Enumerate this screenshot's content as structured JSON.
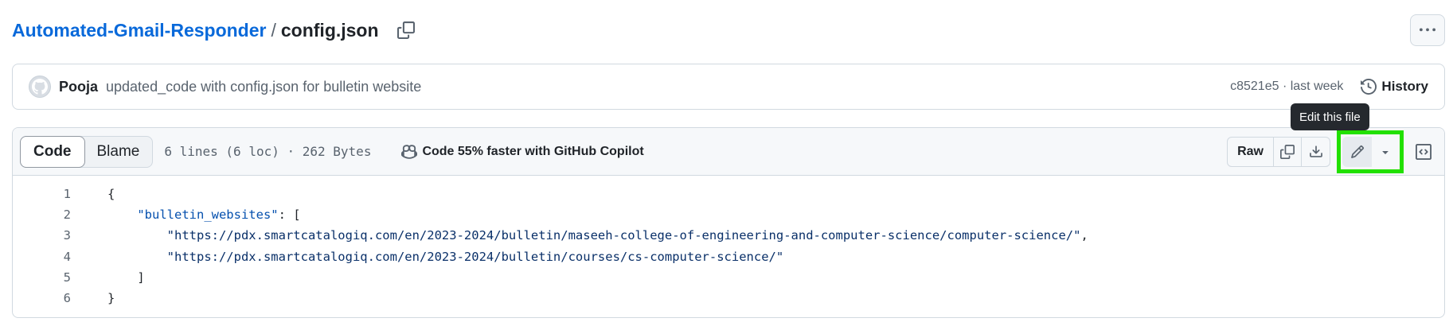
{
  "breadcrumb": {
    "repo": "Automated-Gmail-Responder",
    "separator": "/",
    "file": "config.json"
  },
  "commit": {
    "author": "Pooja",
    "message": "updated_code with config.json for bulletin website",
    "sha_time": "c8521e5 · last week",
    "history_label": "History"
  },
  "tooltip": "Edit this file",
  "file_header": {
    "tabs": [
      "Code",
      "Blame"
    ],
    "active_tab": "Code",
    "meta": "6 lines (6 loc) · 262 Bytes",
    "copilot_label": "Code 55% faster with GitHub Copilot",
    "raw_label": "Raw"
  },
  "icons": {
    "copy": "copy-icon",
    "more": "kebab-horizontal-icon",
    "history": "history-icon",
    "download": "download-icon",
    "edit": "pencil-icon",
    "dropdown": "triangle-down-icon",
    "symbols": "code-square-icon",
    "copilot": "copilot-icon"
  },
  "colors": {
    "link": "#0969da",
    "highlight": "#22e000",
    "tooltip_bg": "#25292e",
    "json_key": "#0550ae",
    "json_string": "#0a3069"
  },
  "code": {
    "line_numbers": [
      "1",
      "2",
      "3",
      "4",
      "5",
      "6"
    ],
    "line1": "{",
    "line2_key": "\"bulletin_websites\"",
    "line2_rest": ": [",
    "line3_string": "\"https://pdx.smartcatalogiq.com/en/2023-2024/bulletin/maseeh-college-of-engineering-and-computer-science/computer-science/\"",
    "line3_rest": ",",
    "line4_string": "\"https://pdx.smartcatalogiq.com/en/2023-2024/bulletin/courses/cs-computer-science/\"",
    "line5": "]",
    "line6": "}"
  }
}
